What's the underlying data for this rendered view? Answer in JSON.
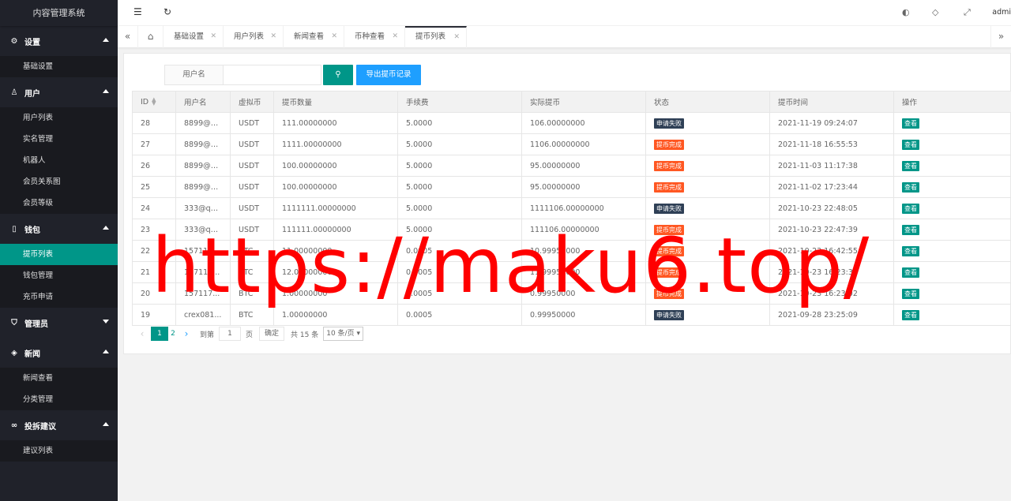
{
  "app": {
    "title": "内容管理系统"
  },
  "sidebar": {
    "groups": [
      {
        "label": "设置",
        "icon": "gear-icon",
        "items": [
          "基础设置"
        ]
      },
      {
        "label": "用户",
        "icon": "user-icon",
        "items": [
          "用户列表",
          "实名管理",
          "机器人",
          "会员关系图",
          "会员等级"
        ]
      },
      {
        "label": "钱包",
        "icon": "wallet-icon",
        "items": [
          "提币列表",
          "钱包管理",
          "充币申请"
        ]
      },
      {
        "label": "管理员",
        "icon": "shield-icon",
        "items": []
      },
      {
        "label": "新闻",
        "icon": "tag-icon",
        "items": [
          "新闻查看",
          "分类管理"
        ]
      },
      {
        "label": "投拆建议",
        "icon": "link-icon",
        "items": [
          "建议列表"
        ]
      }
    ],
    "active_item": "提币列表"
  },
  "header": {
    "user": "admi"
  },
  "tabs": {
    "items": [
      "基础设置",
      "用户列表",
      "新闻查看",
      "币种查看",
      "提币列表"
    ],
    "active": "提币列表"
  },
  "search": {
    "label": "用户名",
    "value": "",
    "export_label": "导出提币记录"
  },
  "table": {
    "columns": [
      "ID",
      "用户名",
      "虚拟币",
      "提币数量",
      "手续费",
      "实际提币",
      "状态",
      "提币时间",
      "操作"
    ],
    "rows": [
      {
        "id": "28",
        "user": "8899@qq...",
        "coin": "USDT",
        "amount": "111.00000000",
        "fee": "5.0000",
        "actual": "106.00000000",
        "status": "申请失败",
        "time": "2021-11-19 09:24:07",
        "action": "查看"
      },
      {
        "id": "27",
        "user": "8899@qq...",
        "coin": "USDT",
        "amount": "1111.00000000",
        "fee": "5.0000",
        "actual": "1106.00000000",
        "status": "提币完成",
        "time": "2021-11-18 16:55:53",
        "action": "查看"
      },
      {
        "id": "26",
        "user": "8899@qq...",
        "coin": "USDT",
        "amount": "100.00000000",
        "fee": "5.0000",
        "actual": "95.00000000",
        "status": "提币完成",
        "time": "2021-11-03 11:17:38",
        "action": "查看"
      },
      {
        "id": "25",
        "user": "8899@qq...",
        "coin": "USDT",
        "amount": "100.00000000",
        "fee": "5.0000",
        "actual": "95.00000000",
        "status": "提币完成",
        "time": "2021-11-02 17:23:44",
        "action": "查看"
      },
      {
        "id": "24",
        "user": "333@qq...",
        "coin": "USDT",
        "amount": "1111111.00000000",
        "fee": "5.0000",
        "actual": "1111106.00000000",
        "status": "申请失败",
        "time": "2021-10-23 22:48:05",
        "action": "查看"
      },
      {
        "id": "23",
        "user": "333@qq...",
        "coin": "USDT",
        "amount": "111111.00000000",
        "fee": "5.0000",
        "actual": "111106.00000000",
        "status": "提币完成",
        "time": "2021-10-23 22:47:39",
        "action": "查看"
      },
      {
        "id": "22",
        "user": "157117...",
        "coin": "BTC",
        "amount": "11.00000000",
        "fee": "0.0005",
        "actual": "10.99950000",
        "status": "提币完成",
        "time": "2021-10-23 16:42:55",
        "action": "查看"
      },
      {
        "id": "21",
        "user": "157117...",
        "coin": "BTC",
        "amount": "12.00000000",
        "fee": "0.0005",
        "actual": "11.99950000",
        "status": "提币完成",
        "time": "2021-10-23 16:23:30",
        "action": "查看"
      },
      {
        "id": "20",
        "user": "157117...",
        "coin": "BTC",
        "amount": "1.00000000",
        "fee": "0.0005",
        "actual": "0.99950000",
        "status": "提币完成",
        "time": "2021-10-23 16:23:02",
        "action": "查看"
      },
      {
        "id": "19",
        "user": "crex081...",
        "coin": "BTC",
        "amount": "1.00000000",
        "fee": "0.0005",
        "actual": "0.99950000",
        "status": "申请失败",
        "time": "2021-09-28 23:25:09",
        "action": "查看"
      }
    ]
  },
  "pager": {
    "current": "1",
    "next_page": "2",
    "goto_label": "到第",
    "goto_value": "1",
    "page_unit": "页",
    "ok_label": "确定",
    "total_label": "共 15 条",
    "size_label": "10 条/页"
  },
  "watermark": "https://maku6.top/",
  "colors": {
    "accent": "#009688",
    "blue": "#1e9fff",
    "fail": "#2f4056",
    "done": "#ff5722",
    "sidebar": "#20222a"
  }
}
